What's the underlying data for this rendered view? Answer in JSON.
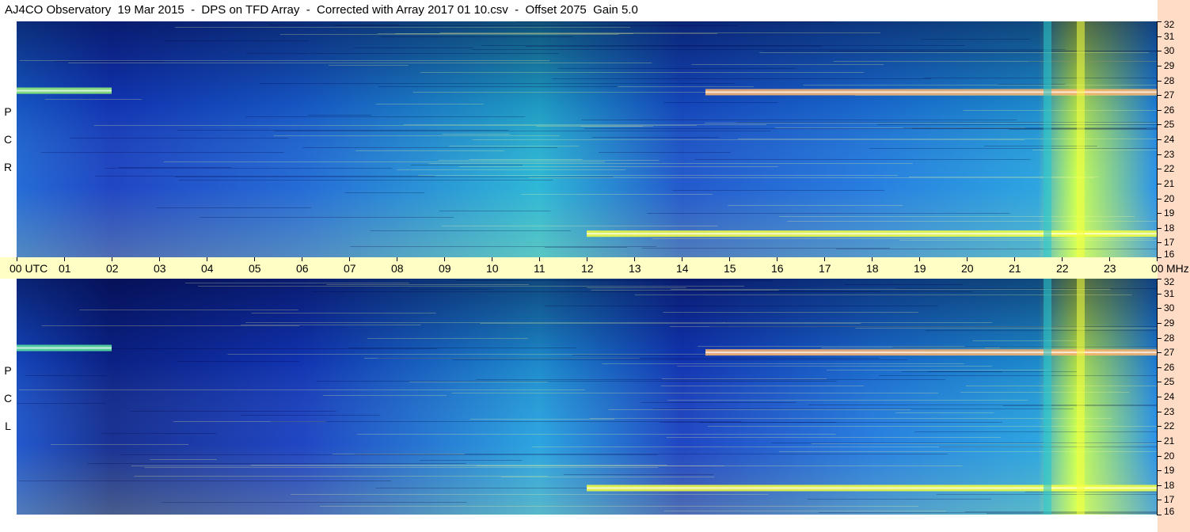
{
  "title": "AJ4CO Observatory  19 Mar 2015  -  DPS on TFD Array  -  Corrected with Array 2017 01 10.csv  -  Offset 2075  Gain 5.0",
  "chart_data": [
    {
      "type": "heatmap",
      "panel_label": "R C P",
      "x_axis": {
        "unit": "UTC",
        "range": [
          0,
          24
        ],
        "ticks": [
          "00 UTC",
          "01",
          "02",
          "03",
          "04",
          "05",
          "06",
          "07",
          "08",
          "09",
          "10",
          "11",
          "12",
          "13",
          "14",
          "15",
          "16",
          "17",
          "18",
          "19",
          "20",
          "21",
          "22",
          "23",
          "00"
        ]
      },
      "y_axis": {
        "unit": "MHz",
        "range": [
          16,
          32
        ],
        "ticks": [
          "16",
          "17",
          "18",
          "19",
          "20",
          "21",
          "22",
          "23",
          "24",
          "25",
          "26",
          "27",
          "28",
          "29",
          "30",
          "31",
          "32"
        ]
      },
      "bands": [
        {
          "hour": 0,
          "intensity": 0.35
        },
        {
          "hour": 2,
          "intensity": 0.25
        },
        {
          "hour": 6,
          "intensity": 0.35
        },
        {
          "hour": 11,
          "intensity": 0.55
        },
        {
          "hour": 14,
          "intensity": 0.3
        },
        {
          "hour": 18,
          "intensity": 0.4
        },
        {
          "hour": 21.5,
          "intensity": 0.5
        },
        {
          "hour": 22.3,
          "intensity": 0.8
        },
        {
          "hour": 24,
          "intensity": 0.45
        }
      ],
      "features": [
        {
          "name": "band",
          "mhz": 27.2,
          "hour_start": 14.5,
          "hour_end": 24,
          "intensity": 0.95
        },
        {
          "name": "band",
          "mhz": 17.6,
          "hour_start": 12,
          "hour_end": 24,
          "intensity": 0.9
        },
        {
          "name": "band",
          "mhz": 27.3,
          "hour_start": 0,
          "hour_end": 2,
          "intensity": 0.75
        }
      ]
    },
    {
      "type": "heatmap",
      "panel_label": "L C P",
      "x_axis": {
        "unit": "UTC",
        "range": [
          0,
          24
        ]
      },
      "y_axis": {
        "unit": "MHz",
        "range": [
          16,
          32
        ],
        "ticks": [
          "16",
          "17",
          "18",
          "19",
          "20",
          "21",
          "22",
          "23",
          "24",
          "25",
          "26",
          "27",
          "28",
          "29",
          "30",
          "31",
          "32"
        ]
      },
      "bands": [
        {
          "hour": 0,
          "intensity": 0.3
        },
        {
          "hour": 2,
          "intensity": 0.15
        },
        {
          "hour": 6,
          "intensity": 0.25
        },
        {
          "hour": 11,
          "intensity": 0.5
        },
        {
          "hour": 14,
          "intensity": 0.25
        },
        {
          "hour": 18,
          "intensity": 0.4
        },
        {
          "hour": 21.5,
          "intensity": 0.5
        },
        {
          "hour": 22.3,
          "intensity": 0.8
        },
        {
          "hour": 24,
          "intensity": 0.45
        }
      ],
      "features": [
        {
          "name": "band",
          "mhz": 27.0,
          "hour_start": 14.5,
          "hour_end": 24,
          "intensity": 0.95
        },
        {
          "name": "band",
          "mhz": 17.8,
          "hour_start": 12,
          "hour_end": 24,
          "intensity": 0.9
        },
        {
          "name": "band",
          "mhz": 27.3,
          "hour_start": 0,
          "hour_end": 2,
          "intensity": 0.7
        }
      ]
    }
  ],
  "colors": {
    "title_bg": "#ffffff",
    "time_axis_bg": "#ffffc5",
    "freq_axis_bg": "#ffdcc5",
    "heat_low": "#000a60",
    "heat_mid": "#2a8cf0",
    "heat_high": "#ffff40",
    "heat_peak": "#ff40c0"
  },
  "axis_unit_label": "MHz"
}
